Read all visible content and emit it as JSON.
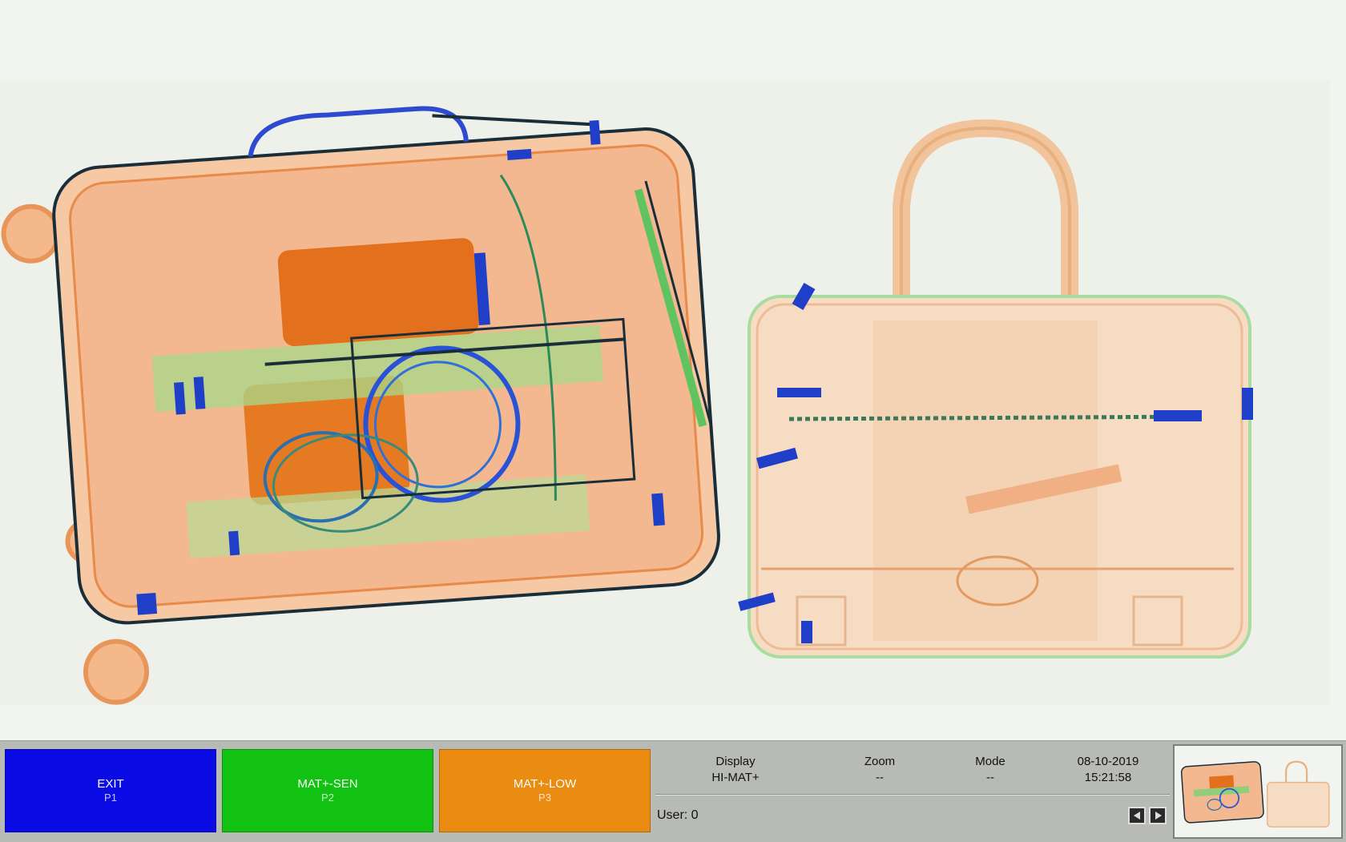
{
  "scan": {
    "description_icon": "xray-baggage-image",
    "colors": {
      "background": "#f2f5ef",
      "organic": "#f0a070",
      "organic_dense": "#e57a2a",
      "inorganic": "#6fcf6f",
      "metal": "#1f3fc8",
      "dark": "#1a2e3a"
    }
  },
  "function_keys": [
    {
      "label": "EXIT",
      "key": "P1",
      "color": "#0b0be6"
    },
    {
      "label": "MAT+-SEN",
      "key": "P2",
      "color": "#12c212"
    },
    {
      "label": "MAT+-LOW",
      "key": "P3",
      "color": "#ea8c12"
    }
  ],
  "status": {
    "display": {
      "header": "Display",
      "value": "HI-MAT+"
    },
    "zoom": {
      "header": "Zoom",
      "value": "--"
    },
    "mode": {
      "header": "Mode",
      "value": "--"
    },
    "date": "08-10-2019",
    "time": "15:21:58",
    "user": "User: 0"
  },
  "navigation": {
    "prev_icon": "triangle-left-icon",
    "next_icon": "triangle-right-icon"
  },
  "thumbnail": {
    "icon": "scan-thumbnail"
  }
}
